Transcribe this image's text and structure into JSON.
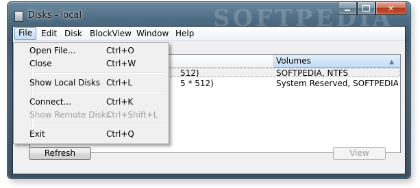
{
  "window": {
    "title": "Disks - local",
    "watermark": "SOFTPEDIA"
  },
  "menubar": [
    "File",
    "Edit",
    "Disk",
    "BlockView",
    "Window",
    "Help"
  ],
  "file_menu": {
    "items": [
      {
        "label": "Open File...",
        "shortcut": "Ctrl+O",
        "enabled": true
      },
      {
        "label": "Close",
        "shortcut": "Ctrl+W",
        "enabled": true
      },
      {
        "label": "Show Local Disks",
        "shortcut": "Ctrl+L",
        "enabled": true
      },
      {
        "label": "Connect...",
        "shortcut": "Ctrl+K",
        "enabled": true
      },
      {
        "label": "Show Remote Disks",
        "shortcut": "Ctrl+Shift+L",
        "enabled": false
      },
      {
        "label": "Exit",
        "shortcut": "Ctrl+Q",
        "enabled": true
      }
    ]
  },
  "table": {
    "columns": [
      {
        "label": ""
      },
      {
        "label": "Volumes",
        "sorted": "ascending"
      }
    ],
    "rows": [
      {
        "size": "512)",
        "volumes": "SOFTPEDIA, NTFS"
      },
      {
        "size": "5 * 512)",
        "volumes": "System Reserved, SOFTPEDIA, , ..."
      }
    ]
  },
  "buttons": {
    "refresh": "Refresh",
    "view": "View"
  },
  "colors": {
    "title_bar": "#4d6b82",
    "close_button": "#c9583a",
    "sort_header": "#c4dcf3"
  }
}
